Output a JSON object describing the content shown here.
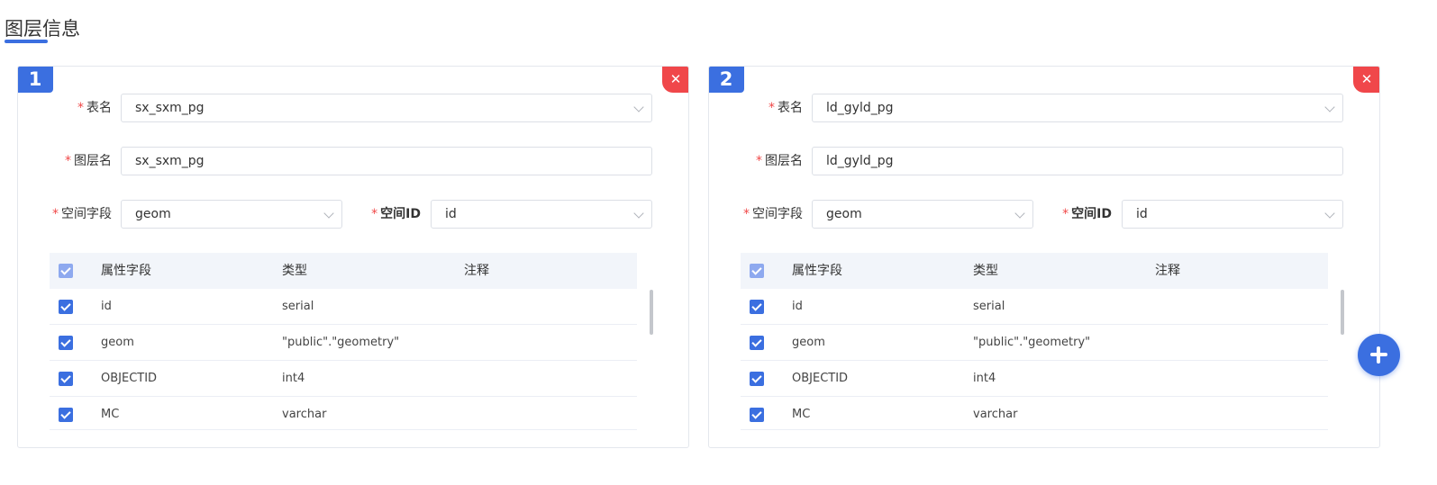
{
  "page": {
    "title": "图层信息"
  },
  "layers": [
    {
      "index": "1",
      "close_icon": "close-icon",
      "table_name": {
        "label": "表名",
        "value": "sx_sxm_pg"
      },
      "layer_name": {
        "label": "图层名",
        "value": "sx_sxm_pg"
      },
      "spatial_field": {
        "label": "空间字段",
        "value": "geom"
      },
      "spatial_id": {
        "label": "空间ID",
        "value": "id"
      },
      "table": {
        "columns": [
          "属性字段",
          "类型",
          "注释"
        ],
        "rows": [
          {
            "field": "id",
            "type": "serial",
            "comment": "",
            "checked": true
          },
          {
            "field": "geom",
            "type": "\"public\".\"geometry\"",
            "comment": "",
            "checked": true
          },
          {
            "field": "OBJECTID",
            "type": "int4",
            "comment": "",
            "checked": true
          },
          {
            "field": "MC",
            "type": "varchar",
            "comment": "",
            "checked": true
          }
        ]
      }
    },
    {
      "index": "2",
      "close_icon": "close-icon",
      "table_name": {
        "label": "表名",
        "value": "ld_gyld_pg"
      },
      "layer_name": {
        "label": "图层名",
        "value": "ld_gyld_pg"
      },
      "spatial_field": {
        "label": "空间字段",
        "value": "geom"
      },
      "spatial_id": {
        "label": "空间ID",
        "value": "id"
      },
      "table": {
        "columns": [
          "属性字段",
          "类型",
          "注释"
        ],
        "rows": [
          {
            "field": "id",
            "type": "serial",
            "comment": "",
            "checked": true
          },
          {
            "field": "geom",
            "type": "\"public\".\"geometry\"",
            "comment": "",
            "checked": true
          },
          {
            "field": "OBJECTID",
            "type": "int4",
            "comment": "",
            "checked": true
          },
          {
            "field": "MC",
            "type": "varchar",
            "comment": "",
            "checked": true
          }
        ]
      }
    }
  ],
  "fab": {
    "icon": "plus-icon"
  },
  "colors": {
    "primary": "#3b6fe0",
    "danger": "#f0474a",
    "required": "#f04848"
  }
}
